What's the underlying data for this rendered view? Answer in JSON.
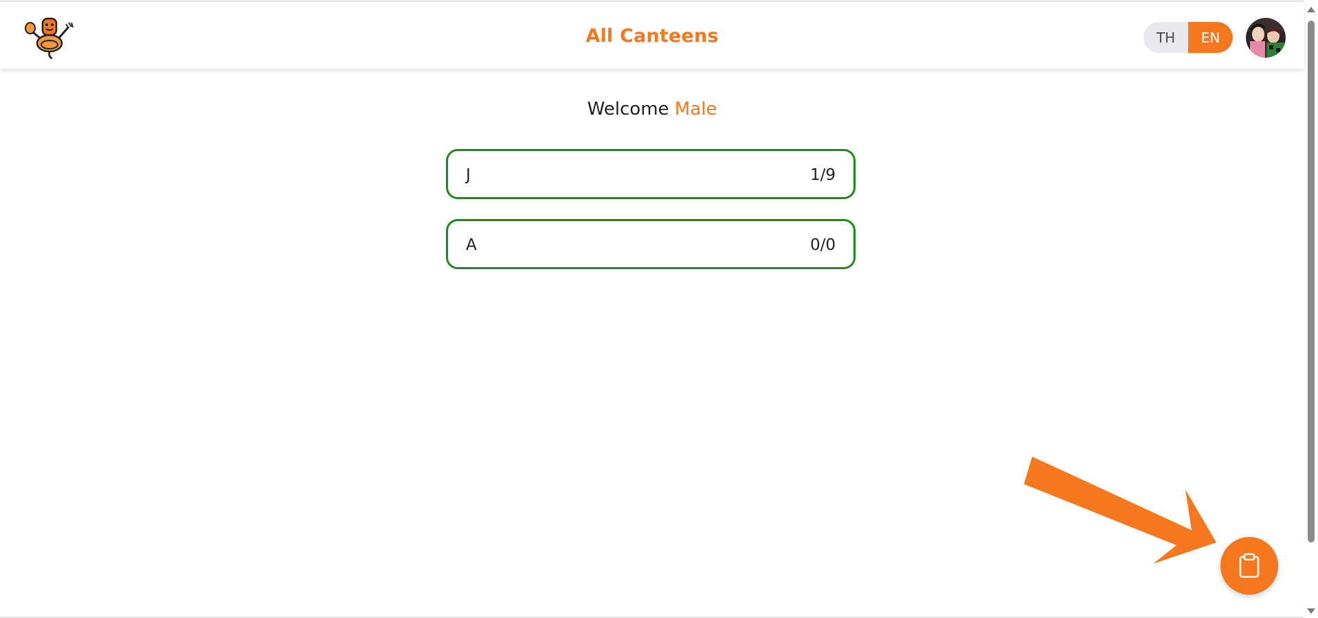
{
  "header": {
    "title": "All Canteens",
    "logo_icon": "mascot-logo-icon",
    "language": {
      "options": [
        "TH",
        "EN"
      ],
      "selected": "EN"
    },
    "avatar_icon": "user-avatar-icon"
  },
  "welcome": {
    "prefix": "Welcome",
    "name": "Male"
  },
  "canteens": [
    {
      "name": "J",
      "count": "1/9"
    },
    {
      "name": "A",
      "count": "0/0"
    }
  ],
  "fab": {
    "icon": "clipboard-icon"
  },
  "annotation": {
    "icon": "arrow-pointer-icon"
  },
  "colors": {
    "accent": "#f5781e",
    "card_border": "#1c8a1c",
    "toggle_bg": "#e9e9ec"
  }
}
